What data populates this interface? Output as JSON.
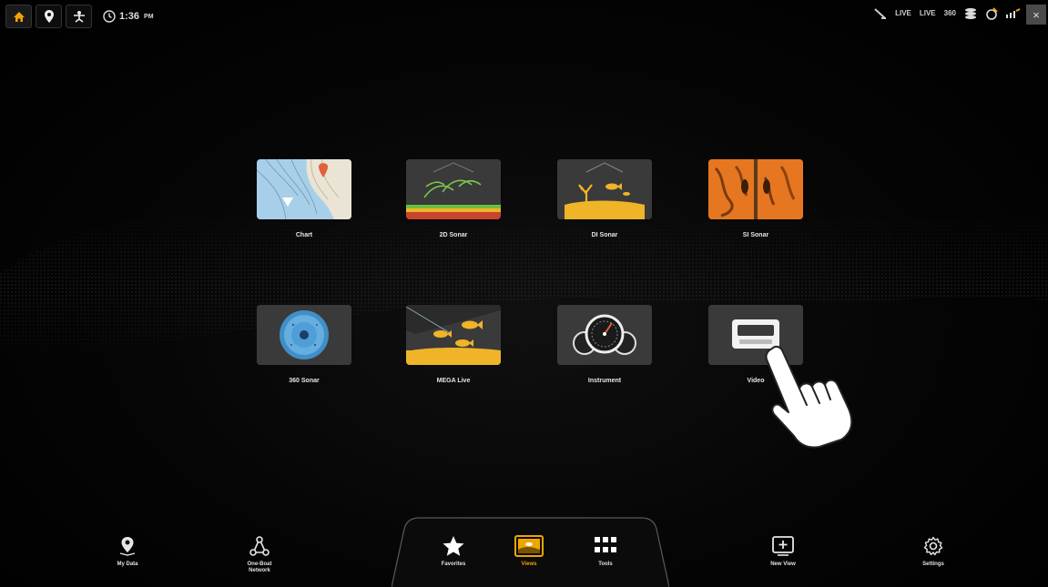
{
  "topbar": {
    "time": "1:36",
    "ampm": "PM",
    "status_icons": [
      {
        "icon": "antenna-icon",
        "text": ""
      },
      {
        "icon": "live-icon",
        "text": "LIVE"
      },
      {
        "icon": "live-icon",
        "text": "LIVE"
      },
      {
        "icon": "sonar-360-icon",
        "text": "360"
      },
      {
        "icon": "network-icon",
        "text": ""
      },
      {
        "icon": "compass-icon",
        "text": ""
      },
      {
        "icon": "signal-icon",
        "text": ""
      }
    ],
    "close_label": "×"
  },
  "views": [
    {
      "label": "Chart",
      "icon": "chart-thumbnail"
    },
    {
      "label": "2D Sonar",
      "icon": "2d-sonar-thumbnail"
    },
    {
      "label": "DI Sonar",
      "icon": "di-sonar-thumbnail"
    },
    {
      "label": "SI Sonar",
      "icon": "si-sonar-thumbnail"
    },
    {
      "label": "360 Sonar",
      "icon": "360-sonar-thumbnail"
    },
    {
      "label": "MEGA Live",
      "icon": "mega-live-thumbnail"
    },
    {
      "label": "Instrument",
      "icon": "instrument-thumbnail"
    },
    {
      "label": "Video",
      "icon": "video-thumbnail"
    }
  ],
  "bottom_nav": {
    "my_data": "My Data",
    "one_boat_network_1": "One-Boat",
    "one_boat_network_2": "Network",
    "favorites": "Favorites",
    "views": "Views",
    "tools": "Tools",
    "new_view": "New View",
    "settings": "Settings"
  },
  "colors": {
    "accent": "#f0a500",
    "background": "#000000",
    "tile": "#3b3b3b"
  }
}
